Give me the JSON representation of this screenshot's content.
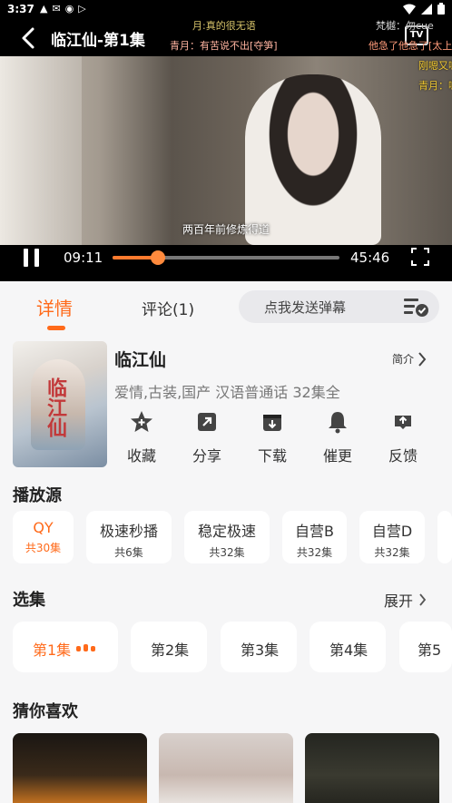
{
  "status_bar": {
    "time": "3:37",
    "icons": [
      "warning-icon",
      "mail-icon",
      "vpn-icon",
      "play-store-icon",
      "wifi-icon",
      "battery-icon"
    ]
  },
  "player": {
    "title": "临江仙-第1集",
    "tv_label": "TV",
    "subtitle": "两百年前修炼得道",
    "current_time": "09:11",
    "total_time": "45:46",
    "progress_fraction": 0.2,
    "danmaku": [
      {
        "text": "月:真的很无语",
        "color": "#d8c46a"
      },
      {
        "text": "梵樾：勿cue",
        "color": "#d0d0d0"
      },
      {
        "text": "青月：有苦说不出[夺笋]",
        "color": "#ffb3a0"
      },
      {
        "text": "他急了他急了[太上",
        "color": "#ff9b7a"
      },
      {
        "text": "刚嗯又嗯",
        "color": "#f0c830"
      },
      {
        "text": "青月：嗯嗯",
        "color": "#f0c830"
      }
    ]
  },
  "tabs": {
    "detail": "详情",
    "comments": "评论(1)",
    "danmu_placeholder": "点我发送弹幕"
  },
  "show": {
    "title": "临江仙",
    "intro_label": "简介",
    "meta": "爱情,古装,国产 汉语普通话 32集全",
    "poster_text": "临江仙",
    "actions": [
      {
        "label": "收藏",
        "icon": "star-plus-icon"
      },
      {
        "label": "分享",
        "icon": "share-icon"
      },
      {
        "label": "下载",
        "icon": "download-icon"
      },
      {
        "label": "催更",
        "icon": "bell-icon"
      },
      {
        "label": "反馈",
        "icon": "feedback-icon"
      }
    ]
  },
  "sources": {
    "title": "播放源",
    "items": [
      {
        "name": "QY",
        "count": "共30集",
        "active": true
      },
      {
        "name": "极速秒播",
        "count": "共6集",
        "active": false
      },
      {
        "name": "稳定极速",
        "count": "共32集",
        "active": false
      },
      {
        "name": "自营B",
        "count": "共32集",
        "active": false
      },
      {
        "name": "自营D",
        "count": "共32集",
        "active": false
      }
    ]
  },
  "episodes": {
    "title": "选集",
    "expand_label": "展开",
    "items": [
      {
        "label": "第1集",
        "active": true
      },
      {
        "label": "第2集",
        "active": false
      },
      {
        "label": "第3集",
        "active": false
      },
      {
        "label": "第4集",
        "active": false
      },
      {
        "label": "第5",
        "active": false
      }
    ]
  },
  "recommend": {
    "title": "猜你喜欢"
  },
  "colors": {
    "accent": "#ff6a1a",
    "progress": "#ff7a2e"
  }
}
